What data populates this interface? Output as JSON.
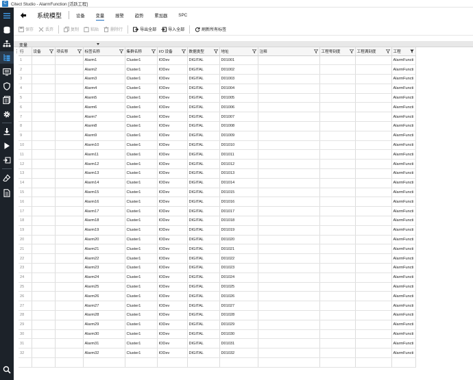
{
  "window": {
    "title": "Citect Studio - AlarmFunction [活跃工程]"
  },
  "header": {
    "breadcrumb": "系统模型",
    "tabs": [
      {
        "label": "设备",
        "active": false
      },
      {
        "label": "变量",
        "active": true
      },
      {
        "label": "报警",
        "active": false
      },
      {
        "label": "趋势",
        "active": false
      },
      {
        "label": "累加器",
        "active": false
      },
      {
        "label": "SPC",
        "active": false
      }
    ]
  },
  "toolbar": {
    "save": "保存",
    "discard": "丢弃",
    "copy": "复制",
    "paste": "粘贴",
    "delete_row": "删除行",
    "export_all": "导出全部",
    "import_all": "导入全部",
    "refresh_tags": "刷新所有标签"
  },
  "subheader": {
    "label": "变量"
  },
  "columns": [
    "行",
    "设备",
    "项名称",
    "标签名称",
    "集群名称",
    "I/O 设备",
    "数据类型",
    "地址",
    "注释",
    "工程零刻度",
    "工程满刻度",
    "工程"
  ],
  "rows": [
    [
      "1",
      "",
      "",
      "Alarm1",
      "Cluster1",
      "IODev",
      "DIGITAL",
      "D01001",
      "",
      "",
      "",
      "AlarmFuncti"
    ],
    [
      "2",
      "",
      "",
      "Alarm2",
      "Cluster1",
      "IODev",
      "DIGITAL",
      "D01002",
      "",
      "",
      "",
      "AlarmFuncti"
    ],
    [
      "3",
      "",
      "",
      "Alarm3",
      "Cluster1",
      "IODev",
      "DIGITAL",
      "D01003",
      "",
      "",
      "",
      "AlarmFuncti"
    ],
    [
      "4",
      "",
      "",
      "Alarm4",
      "Cluster1",
      "IODev",
      "DIGITAL",
      "D01004",
      "",
      "",
      "",
      "AlarmFuncti"
    ],
    [
      "5",
      "",
      "",
      "Alarm5",
      "Cluster1",
      "IODev",
      "DIGITAL",
      "D01005",
      "",
      "",
      "",
      "AlarmFuncti"
    ],
    [
      "6",
      "",
      "",
      "Alarm6",
      "Cluster1",
      "IODev",
      "DIGITAL",
      "D01006",
      "",
      "",
      "",
      "AlarmFuncti"
    ],
    [
      "7",
      "",
      "",
      "Alarm7",
      "Cluster1",
      "IODev",
      "DIGITAL",
      "D01007",
      "",
      "",
      "",
      "AlarmFuncti"
    ],
    [
      "8",
      "",
      "",
      "Alarm8",
      "Cluster1",
      "IODev",
      "DIGITAL",
      "D01008",
      "",
      "",
      "",
      "AlarmFuncti"
    ],
    [
      "9",
      "",
      "",
      "Alarm9",
      "Cluster1",
      "IODev",
      "DIGITAL",
      "D01009",
      "",
      "",
      "",
      "AlarmFuncti"
    ],
    [
      "10",
      "",
      "",
      "Alarm10",
      "Cluster1",
      "IODev",
      "DIGITAL",
      "D01010",
      "",
      "",
      "",
      "AlarmFuncti"
    ],
    [
      "11",
      "",
      "",
      "Alarm11",
      "Cluster1",
      "IODev",
      "DIGITAL",
      "D01011",
      "",
      "",
      "",
      "AlarmFuncti"
    ],
    [
      "12",
      "",
      "",
      "Alarm12",
      "Cluster1",
      "IODev",
      "DIGITAL",
      "D01012",
      "",
      "",
      "",
      "AlarmFuncti"
    ],
    [
      "13",
      "",
      "",
      "Alarm13",
      "Cluster1",
      "IODev",
      "DIGITAL",
      "D01013",
      "",
      "",
      "",
      "AlarmFuncti"
    ],
    [
      "14",
      "",
      "",
      "Alarm14",
      "Cluster1",
      "IODev",
      "DIGITAL",
      "D01014",
      "",
      "",
      "",
      "AlarmFuncti"
    ],
    [
      "15",
      "",
      "",
      "Alarm15",
      "Cluster1",
      "IODev",
      "DIGITAL",
      "D01015",
      "",
      "",
      "",
      "AlarmFuncti"
    ],
    [
      "16",
      "",
      "",
      "Alarm16",
      "Cluster1",
      "IODev",
      "DIGITAL",
      "D01016",
      "",
      "",
      "",
      "AlarmFuncti"
    ],
    [
      "17",
      "",
      "",
      "Alarm17",
      "Cluster1",
      "IODev",
      "DIGITAL",
      "D01017",
      "",
      "",
      "",
      "AlarmFuncti"
    ],
    [
      "18",
      "",
      "",
      "Alarm18",
      "Cluster1",
      "IODev",
      "DIGITAL",
      "D01018",
      "",
      "",
      "",
      "AlarmFuncti"
    ],
    [
      "19",
      "",
      "",
      "Alarm19",
      "Cluster1",
      "IODev",
      "DIGITAL",
      "D01019",
      "",
      "",
      "",
      "AlarmFuncti"
    ],
    [
      "20",
      "",
      "",
      "Alarm20",
      "Cluster1",
      "IODev",
      "DIGITAL",
      "D01020",
      "",
      "",
      "",
      "AlarmFuncti"
    ],
    [
      "21",
      "",
      "",
      "Alarm21",
      "Cluster1",
      "IODev",
      "DIGITAL",
      "D01021",
      "",
      "",
      "",
      "AlarmFuncti"
    ],
    [
      "22",
      "",
      "",
      "Alarm22",
      "Cluster1",
      "IODev",
      "DIGITAL",
      "D01022",
      "",
      "",
      "",
      "AlarmFuncti"
    ],
    [
      "23",
      "",
      "",
      "Alarm23",
      "Cluster1",
      "IODev",
      "DIGITAL",
      "D01023",
      "",
      "",
      "",
      "AlarmFuncti"
    ],
    [
      "24",
      "",
      "",
      "Alarm24",
      "Cluster1",
      "IODev",
      "DIGITAL",
      "D01024",
      "",
      "",
      "",
      "AlarmFuncti"
    ],
    [
      "25",
      "",
      "",
      "Alarm25",
      "Cluster1",
      "IODev",
      "DIGITAL",
      "D01025",
      "",
      "",
      "",
      "AlarmFuncti"
    ],
    [
      "26",
      "",
      "",
      "Alarm26",
      "Cluster1",
      "IODev",
      "DIGITAL",
      "D01026",
      "",
      "",
      "",
      "AlarmFuncti"
    ],
    [
      "27",
      "",
      "",
      "Alarm27",
      "Cluster1",
      "IODev",
      "DIGITAL",
      "D01027",
      "",
      "",
      "",
      "AlarmFuncti"
    ],
    [
      "28",
      "",
      "",
      "Alarm28",
      "Cluster1",
      "IODev",
      "DIGITAL",
      "D01028",
      "",
      "",
      "",
      "AlarmFuncti"
    ],
    [
      "29",
      "",
      "",
      "Alarm29",
      "Cluster1",
      "IODev",
      "DIGITAL",
      "D01029",
      "",
      "",
      "",
      "AlarmFuncti"
    ],
    [
      "30",
      "",
      "",
      "Alarm30",
      "Cluster1",
      "IODev",
      "DIGITAL",
      "D01030",
      "",
      "",
      "",
      "AlarmFuncti"
    ],
    [
      "31",
      "",
      "",
      "Alarm31",
      "Cluster1",
      "IODev",
      "DIGITAL",
      "D01031",
      "",
      "",
      "",
      "AlarmFuncti"
    ],
    [
      "32",
      "",
      "",
      "Alarm32",
      "Cluster1",
      "IODev",
      "DIGITAL",
      "D01032",
      "",
      "",
      "",
      "AlarmFuncti"
    ]
  ],
  "colors": {
    "sidebar": "#1c2229",
    "accent": "#1e6fbf",
    "header_bg": "#f6f6f6"
  }
}
